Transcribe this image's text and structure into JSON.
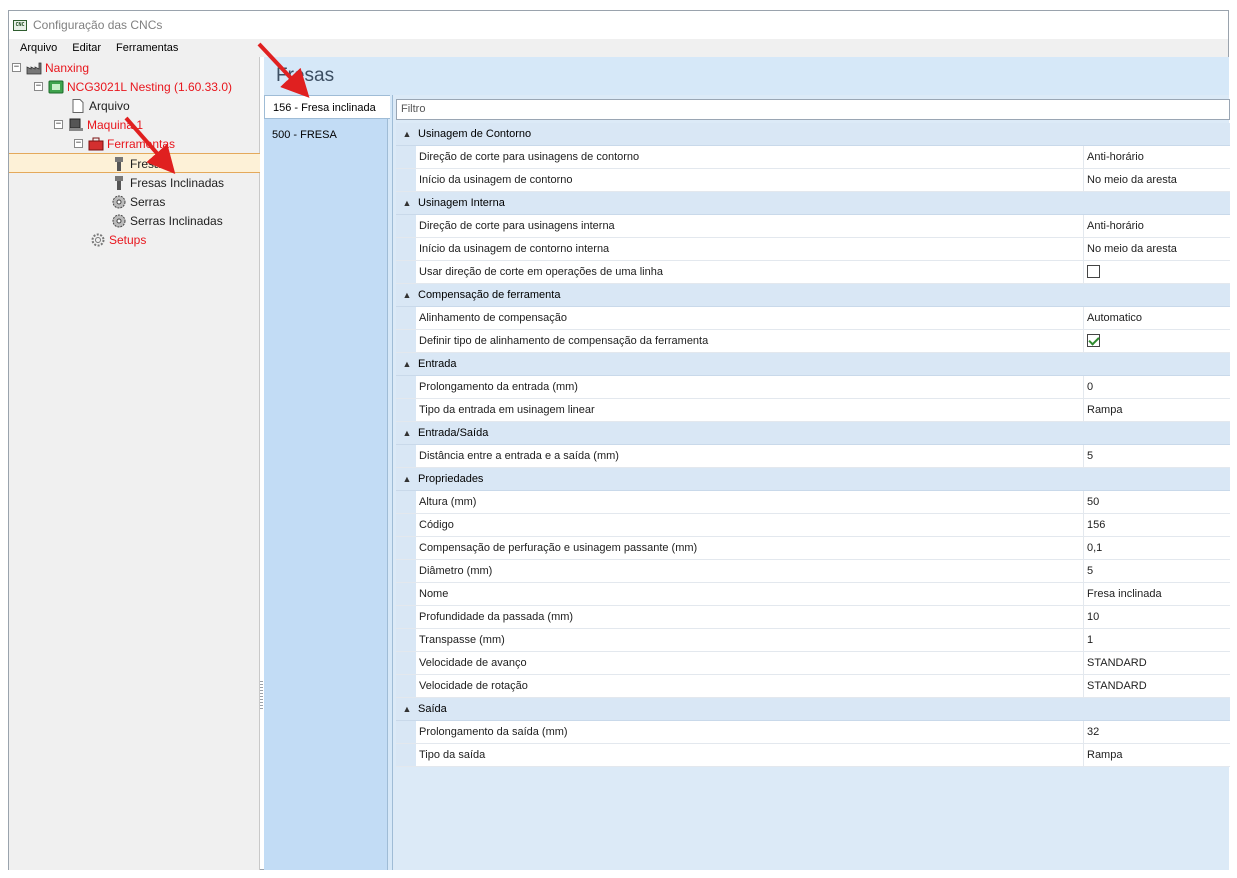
{
  "window": {
    "title": "Configuração das CNCs",
    "app_icon_text": "CNC"
  },
  "menu": [
    "Arquivo",
    "Editar",
    "Ferramentas"
  ],
  "tree": {
    "root": "Nanxing",
    "machine": "NCG3021L Nesting (1.60.33.0)",
    "file": "Arquivo",
    "maquina": "Maquina 1",
    "tools": "Ferramentas",
    "fresas": "Fresas",
    "fresas_inclinadas": "Fresas Inclinadas",
    "serras": "Serras",
    "serras_inclinadas": "Serras Inclinadas",
    "setups": "Setups"
  },
  "page_heading": "Fresas",
  "tool_list": [
    "156 - Fresa inclinada",
    "500 - FRESA"
  ],
  "filter_placeholder": "Filtro",
  "groups": [
    {
      "title": "Usinagem de Contorno",
      "rows": [
        {
          "name": "Direção de corte para usinagens de contorno",
          "value": "Anti-horário"
        },
        {
          "name": "Início da usinagem de contorno",
          "value": "No meio da aresta"
        }
      ]
    },
    {
      "title": "Usinagem Interna",
      "rows": [
        {
          "name": "Direção de corte para usinagens interna",
          "value": "Anti-horário"
        },
        {
          "name": "Início da usinagem de contorno interna",
          "value": "No meio da aresta"
        },
        {
          "name": "Usar direção de corte em operações de uma linha",
          "checkbox": false
        }
      ]
    },
    {
      "title": "Compensação de ferramenta",
      "rows": [
        {
          "name": "Alinhamento de compensação",
          "value": "Automatico"
        },
        {
          "name": "Definir tipo de alinhamento de compensação da ferramenta",
          "checkbox": true
        }
      ]
    },
    {
      "title": "Entrada",
      "rows": [
        {
          "name": "Prolongamento da entrada (mm)",
          "value": "0"
        },
        {
          "name": "Tipo da entrada em usinagem linear",
          "value": "Rampa"
        }
      ]
    },
    {
      "title": "Entrada/Saída",
      "rows": [
        {
          "name": "Distância entre a entrada e a saída (mm)",
          "value": "5"
        }
      ]
    },
    {
      "title": "Propriedades",
      "rows": [
        {
          "name": "Altura (mm)",
          "value": "50"
        },
        {
          "name": "Código",
          "value": "156"
        },
        {
          "name": "Compensação de perfuração e usinagem passante (mm)",
          "value": "0,1"
        },
        {
          "name": "Diâmetro (mm)",
          "value": "5"
        },
        {
          "name": "Nome",
          "value": "Fresa inclinada"
        },
        {
          "name": "Profundidade da passada (mm)",
          "value": "10"
        },
        {
          "name": "Transpasse (mm)",
          "value": "1"
        },
        {
          "name": "Velocidade de avanço",
          "value": "STANDARD"
        },
        {
          "name": "Velocidade de rotação",
          "value": "STANDARD"
        }
      ]
    },
    {
      "title": "Saída",
      "rows": [
        {
          "name": "Prolongamento da saída (mm)",
          "value": "32"
        },
        {
          "name": "Tipo da saída",
          "value": "Rampa"
        }
      ]
    }
  ],
  "colors": {
    "accent_red": "#e8161d",
    "annotation_arrow": "#e02020",
    "panel_blue": "#d6e8f8",
    "selection": "#fdf1d7"
  }
}
